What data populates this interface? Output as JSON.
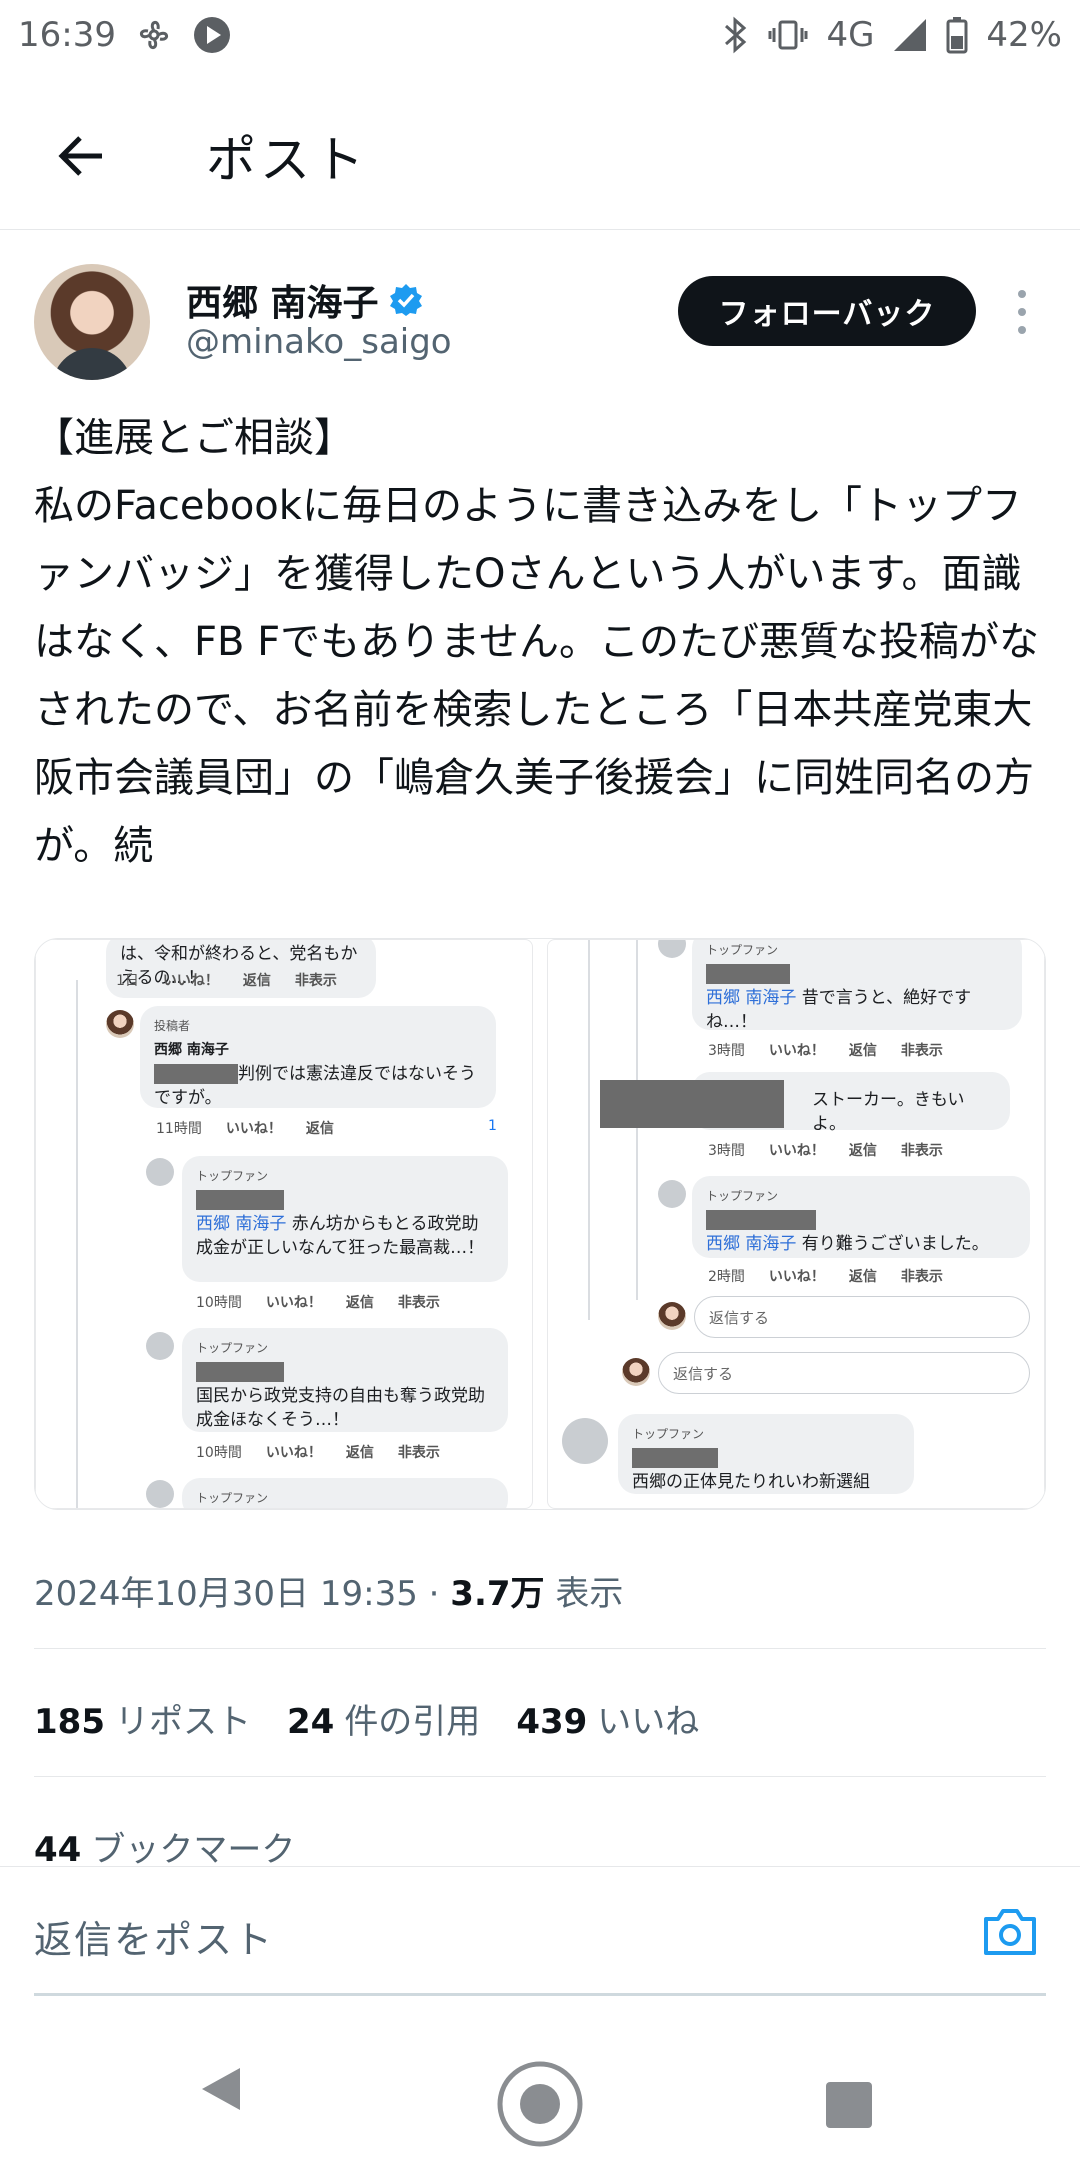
{
  "status_bar": {
    "time": "16:39",
    "network": "4G",
    "battery": "42%"
  },
  "header": {
    "title": "ポスト"
  },
  "author": {
    "name": "西郷 南海子",
    "handle": "@minako_saigo",
    "follow_label": "フォローバック"
  },
  "tweet": {
    "text": "【進展とご相談】\n私のFacebookに毎日のように書き込みをし「トップファンバッジ」を獲得したOさんという人がいます。面識はなく、FB Fでもありません。このたび悪質な投稿がなされたので、お名前を検索したところ「日本共産党東大阪市会議員団」の「嶋倉久美子後援会」に同姓同名の方が。続"
  },
  "media": {
    "left": {
      "top_text": "は、令和が終わると、党名もかえるの…！",
      "top_meta": [
        "1日",
        "いいね！",
        "返信",
        "非表示"
      ],
      "author_badge": "投稿者",
      "author_name": "西郷 南海子",
      "author_text": "判例では憲法違反ではないそうですが。",
      "author_meta": [
        "11時間",
        "いいね！",
        "返信"
      ],
      "author_likes": "1",
      "fan_label": "トップファン",
      "reply1_mention": "西郷 南海子",
      "reply1_text": " 赤ん坊からもとる政党助成金が正しいなんて狂った最高裁…！",
      "reply1_meta": [
        "10時間",
        "いいね！",
        "返信",
        "非表示"
      ],
      "reply2_text": "国民から政党支持の自由も奪う政党助成金ほなくそう…！",
      "reply2_meta": [
        "10時間",
        "いいね！",
        "返信",
        "非表示"
      ]
    },
    "right": {
      "fan_label": "トップファン",
      "r1_mention": "西郷 南海子",
      "r1_text": " 昔で言うと、絶好ですね…！",
      "r1_meta": [
        "3時間",
        "いいね！",
        "返信",
        "非表示"
      ],
      "r2_text": "ストーカー。きもいよ。",
      "r2_meta": [
        "3時間",
        "いいね！",
        "返信",
        "非表示"
      ],
      "r3_mention": "西郷 南海子",
      "r3_text": " 有り難うございました。",
      "r3_meta": [
        "2時間",
        "いいね！",
        "返信",
        "非表示"
      ],
      "reply_placeholder_1": "返信する",
      "reply_placeholder_2": "返信する",
      "last_text": "西郷の正体見たりれいわ新選組"
    }
  },
  "timestamp": {
    "date": "2024年10月30日 19:35 · ",
    "views_count": "3.7万",
    "views_label": " 表示"
  },
  "stats": {
    "reposts_count": "185",
    "reposts_label": "リポスト",
    "quotes_count": "24",
    "quotes_label": "件の引用",
    "likes_count": "439",
    "likes_label": "いいね",
    "bookmarks_count": "44",
    "bookmarks_label": "ブックマーク"
  },
  "reply_bar": {
    "placeholder": "返信をポスト"
  },
  "colors": {
    "accent": "#1d9bf0",
    "text": "#0f1419",
    "secondary": "#536471"
  },
  "icons": {
    "back": "arrow-left-icon",
    "verified": "verified-badge-icon",
    "more": "more-vertical-icon",
    "camera": "camera-icon"
  }
}
